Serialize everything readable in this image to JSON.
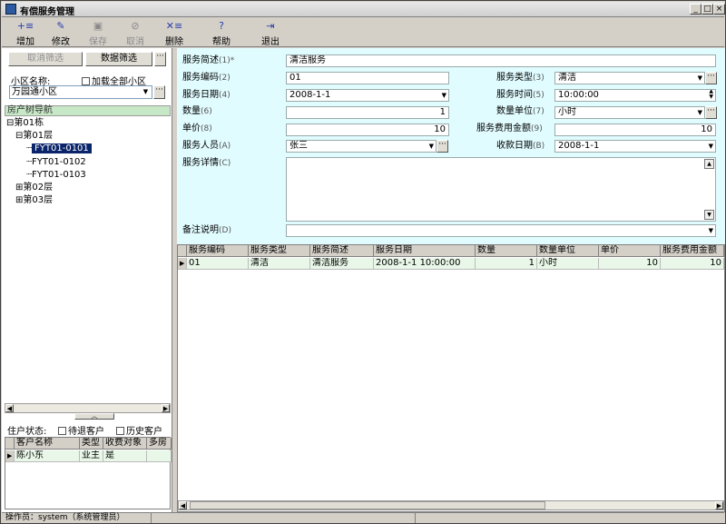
{
  "window": {
    "title": "有偿服务管理",
    "min": "_",
    "max": "□",
    "close": "×"
  },
  "toolbar": [
    {
      "label": "增加",
      "icon": "+≡",
      "enabled": true
    },
    {
      "label": "修改",
      "icon": "✎",
      "enabled": true
    },
    {
      "label": "保存",
      "icon": "▣",
      "enabled": false
    },
    {
      "label": "取消",
      "icon": "⊘",
      "enabled": false
    },
    {
      "label": "删除",
      "icon": "✕≡",
      "enabled": true
    },
    {
      "label": "帮助",
      "icon": "?",
      "enabled": true
    },
    {
      "label": "退出",
      "icon": "⇥",
      "enabled": true
    }
  ],
  "left": {
    "cancel_filter": "取消筛选",
    "data_filter": "数据筛选",
    "dots": "···",
    "community_label": "小区名称:",
    "load_all": "加载全部小区",
    "community_value": "万园通小区",
    "nav_title": "房产树导航",
    "tree": [
      {
        "text": "第01栋",
        "prefix": "⊟"
      },
      {
        "text": "第01层",
        "prefix": "⊟"
      },
      {
        "text": "FYT01-0101",
        "prefix": "┈"
      },
      {
        "text": "FYT01-0102",
        "prefix": "┈"
      },
      {
        "text": "FYT01-0103",
        "prefix": "┈"
      },
      {
        "text": "第02层",
        "prefix": "⊞"
      },
      {
        "text": "第03层",
        "prefix": "⊞"
      }
    ],
    "collapse": "︿",
    "resident_status": "住户状态:",
    "pending_exit": "待退客户",
    "history": "历史客户",
    "cust_headers": [
      "客户名称",
      "类型",
      "收费对象",
      "多房"
    ],
    "cust_row": [
      "陈小东",
      "业主",
      "是",
      ""
    ]
  },
  "form": {
    "desc_label": "服务简述",
    "desc_hint": "(1)*",
    "desc_value": "清洁服务",
    "code_label": "服务编码",
    "code_hint": "(2)",
    "code_value": "01",
    "type_label": "服务类型",
    "type_hint": "(3)",
    "type_value": "清洁",
    "date_label": "服务日期",
    "date_hint": "(4)",
    "date_value": "2008-1-1",
    "time_label": "服务时间",
    "time_hint": "(5)",
    "time_value": "10:00:00",
    "qty_label": "数量",
    "qty_hint": "(6)",
    "qty_value": "1",
    "unit_label": "数量单位",
    "unit_hint": "(7)",
    "unit_value": "小时",
    "price_label": "单价",
    "price_hint": "(8)",
    "price_value": "10",
    "amount_label": "服务费用金额",
    "amount_hint": "(9)",
    "amount_value": "10",
    "staff_label": "服务人员",
    "staff_hint": "(A)",
    "staff_value": "张三",
    "collect_label": "收款日期",
    "collect_hint": "(B)",
    "collect_value": "2008-1-1",
    "detail_label": "服务详情",
    "detail_hint": "(C)",
    "remark_label": "备注说明",
    "remark_hint": "(D)"
  },
  "table": {
    "headers": [
      "服务编码",
      "服务类型",
      "服务简述",
      "服务日期",
      "数量",
      "数量单位",
      "单价",
      "服务费用金额"
    ],
    "row": [
      "01",
      "清洁",
      "清洁服务",
      "2008-1-1  10:00:00",
      "1",
      "小时",
      "10",
      "10"
    ]
  },
  "status": {
    "operator": "操作员：system（系统管理员）"
  }
}
